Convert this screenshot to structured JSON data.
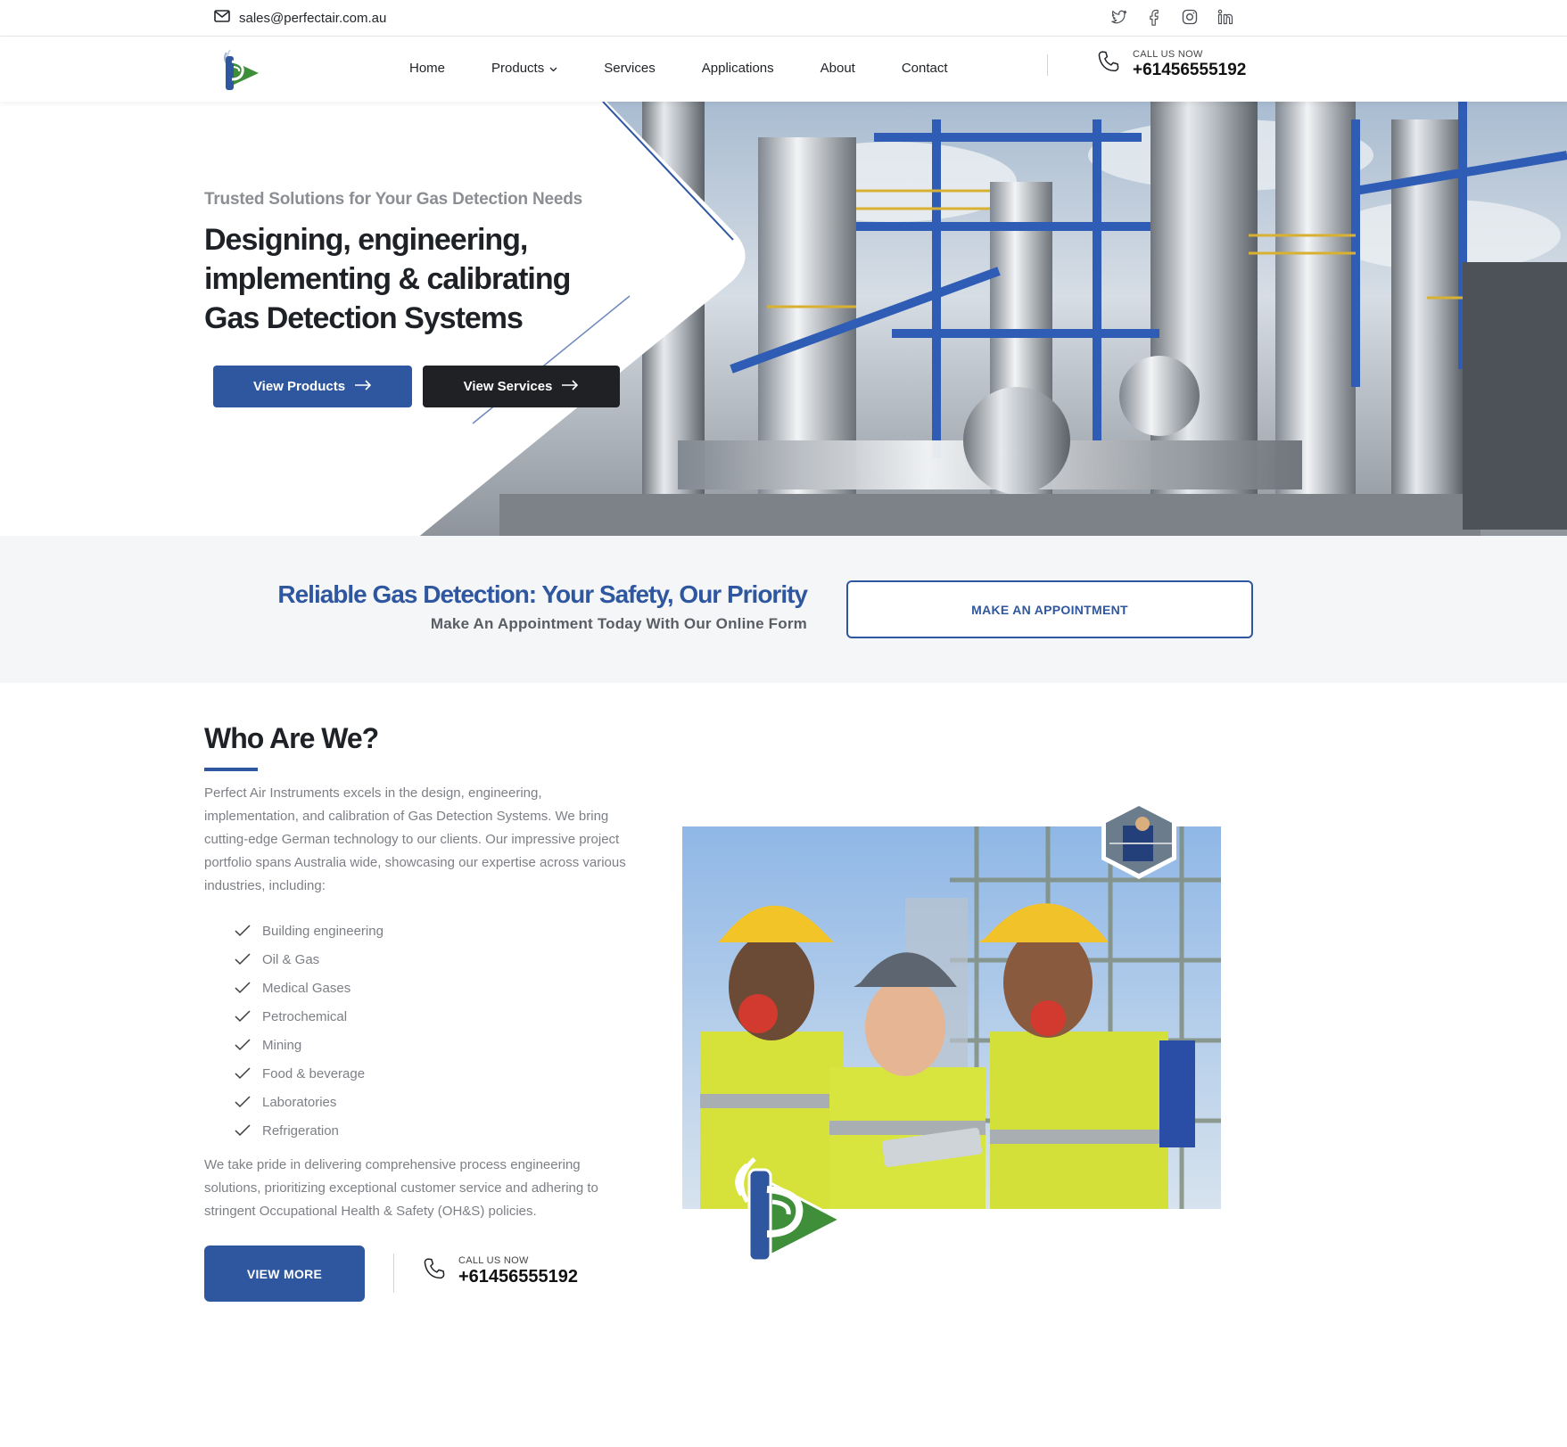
{
  "topbar": {
    "email": "sales@perfectair.com.au",
    "socials": [
      "twitter-icon",
      "facebook-icon",
      "instagram-icon",
      "linkedin-icon"
    ]
  },
  "nav": {
    "items": [
      {
        "label": "Home"
      },
      {
        "label": "Products"
      },
      {
        "label": "Services"
      },
      {
        "label": "Applications"
      },
      {
        "label": "About"
      },
      {
        "label": "Contact"
      }
    ],
    "call_label": "CALL US NOW",
    "call_number": "+61456555192"
  },
  "hero": {
    "tagline": "Trusted Solutions for Your Gas Detection Needs",
    "headline": "Designing, engineering, implementing & calibrating Gas Detection Systems",
    "btn_products": "View Products",
    "btn_services": "View Services"
  },
  "band": {
    "headline": "Reliable Gas Detection: Your Safety, Our Priority",
    "subline": "Make An Appointment Today With Our Online Form",
    "button": "MAKE AN APPOINTMENT"
  },
  "who": {
    "title": "Who Are We?",
    "intro": "Perfect Air Instruments excels in the design, engineering, implementation, and calibration of Gas Detection Systems. We bring cutting-edge German technology to our clients. Our impressive project portfolio spans Australia wide, showcasing our expertise across various industries, including:",
    "industries": [
      "Building engineering",
      "Oil & Gas",
      "Medical Gases",
      "Petrochemical",
      "Mining",
      "Food & beverage",
      "Laboratories",
      "Refrigeration"
    ],
    "outro": "We take pride in delivering comprehensive process engineering solutions, prioritizing exceptional customer service and adhering to stringent Occupational Health & Safety (OH&S) policies.",
    "btn_more": "VIEW MORE",
    "call_label": "CALL US NOW",
    "call_number": "+61456555192"
  },
  "colors": {
    "brand_blue": "#2f57a0",
    "brand_green": "#3f8f3a",
    "dark": "#1f2125",
    "band_bg": "#f5f6f7"
  }
}
